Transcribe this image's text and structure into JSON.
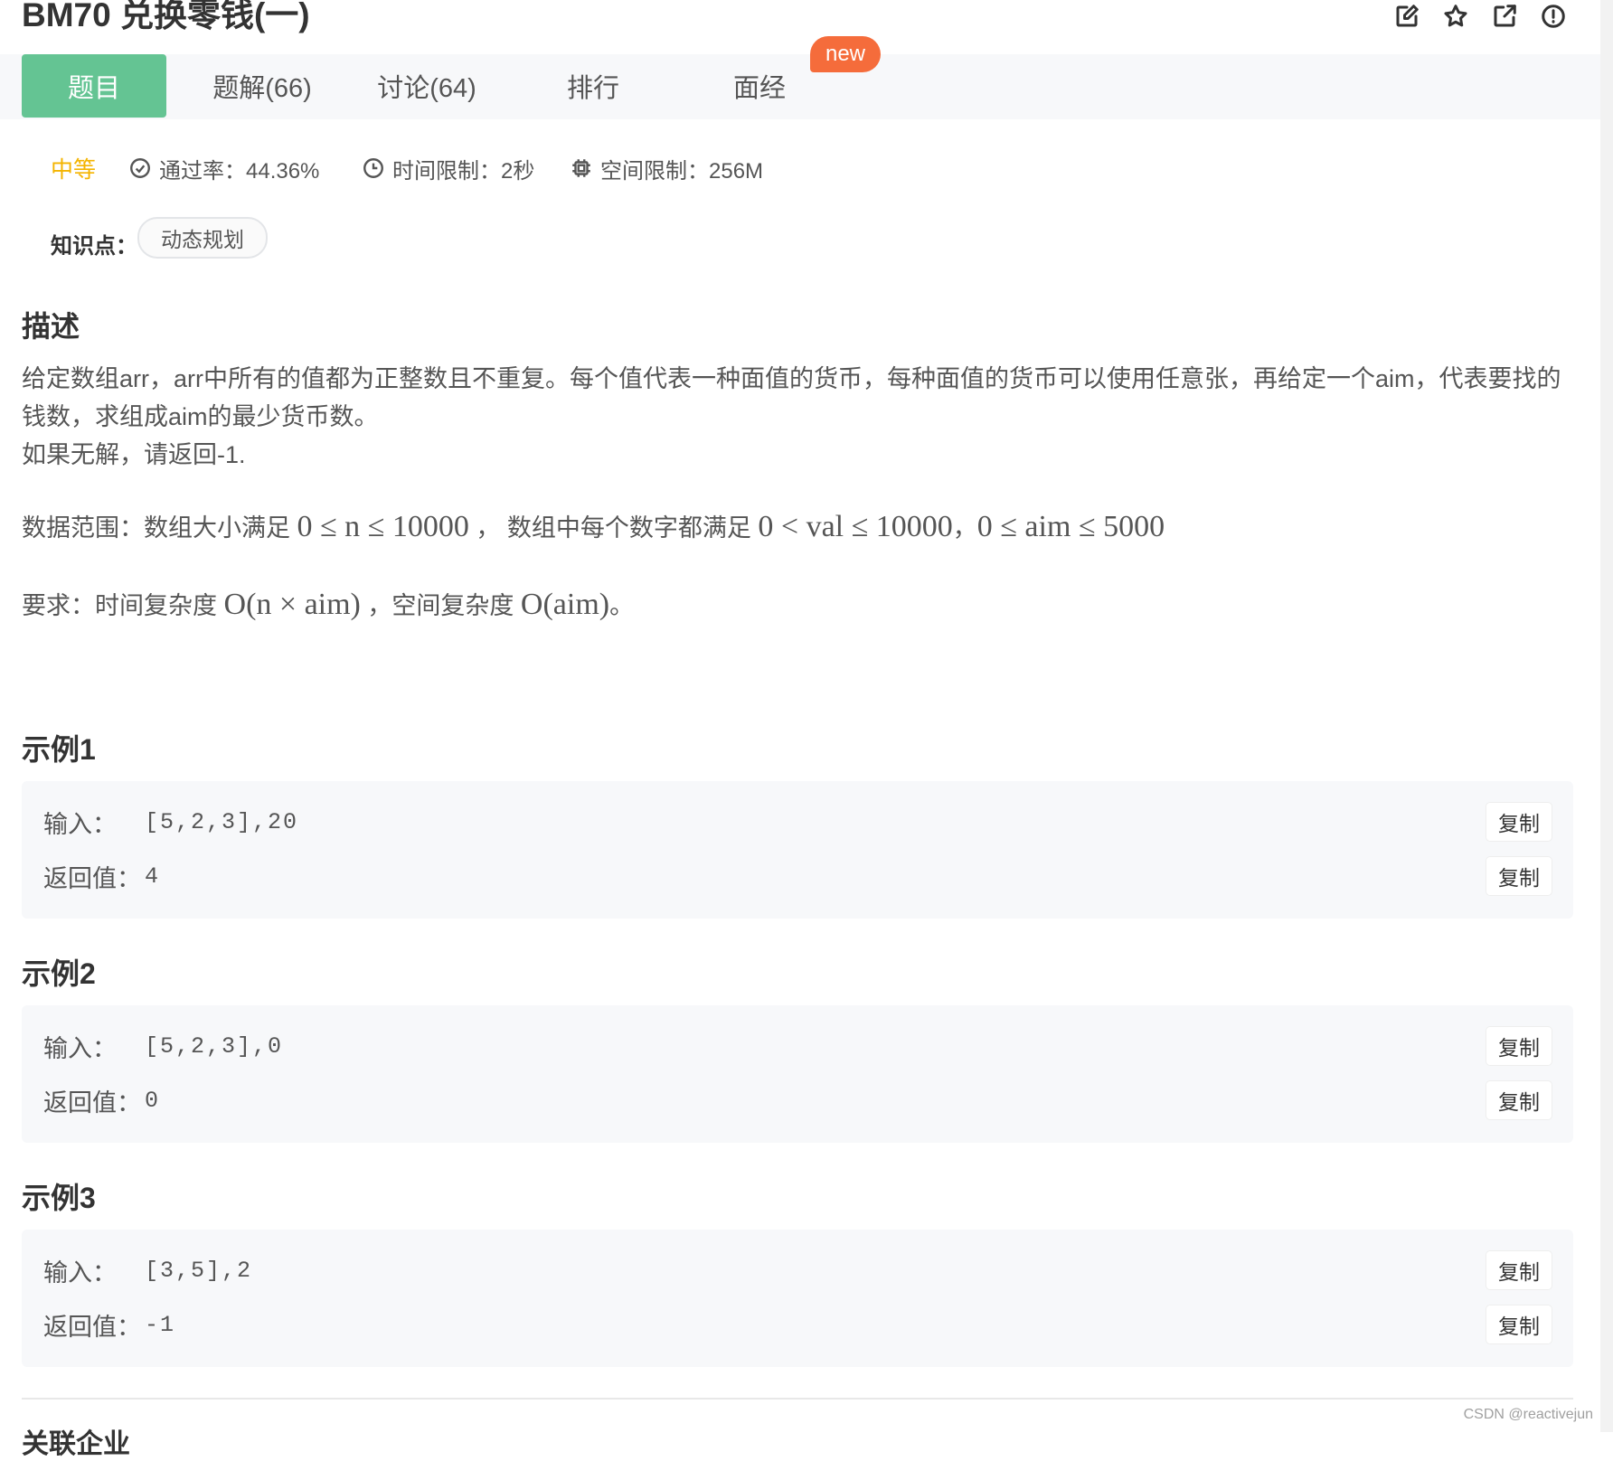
{
  "header": {
    "title": "BM70  兑换零钱(一)",
    "toolbar_icons": [
      "edit-icon",
      "star-icon",
      "share-icon",
      "report-icon"
    ]
  },
  "tabs": [
    {
      "label": "题目",
      "active": true
    },
    {
      "label": "题解(66)",
      "active": false
    },
    {
      "label": "讨论(64)",
      "active": false
    },
    {
      "label": "排行",
      "active": false
    },
    {
      "label": "面经",
      "active": false
    }
  ],
  "new_badge": "new",
  "meta": {
    "difficulty": "中等",
    "pass_rate": "通过率：44.36%",
    "time_limit": "时间限制：2秒",
    "space_limit": "空间限制：256M"
  },
  "knowledge": {
    "label": "知识点：",
    "tag": "动态规划"
  },
  "description": {
    "heading": "描述",
    "line1": "给定数组arr，arr中所有的值都为正整数且不重复。每个值代表一种面值的货币，每种面值的货币可以使用任意张，再给定一个aim，代表要找的钱数，求组成aim的最少货币数。",
    "line2": "如果无解，请返回-1.",
    "range_label": "数据范围：数组大小满足",
    "range_expr1": "0 ≤ n ≤ 10000",
    "range_mid": "， 数组中每个数字都满足",
    "range_expr2": "0 < val ≤ 10000",
    "range_sep": "，",
    "range_expr3": "0 ≤ aim ≤ 5000",
    "req_label": "要求：时间复杂度",
    "req_expr1": "O(n × aim)",
    "req_mid": "，空间复杂度",
    "req_expr2": "O(aim)",
    "req_end": "。"
  },
  "examples": [
    {
      "heading": "示例1",
      "input_label": "输入：",
      "input": "[5,2,3],20",
      "output_label": "返回值：",
      "output": "4",
      "copy": "复制"
    },
    {
      "heading": "示例2",
      "input_label": "输入：",
      "input": "[5,2,3],0",
      "output_label": "返回值：",
      "output": "0",
      "copy": "复制"
    },
    {
      "heading": "示例3",
      "input_label": "输入：",
      "input": "[3,5],2",
      "output_label": "返回值：",
      "output": "-1",
      "copy": "复制"
    }
  ],
  "footer": {
    "watermark": "CSDN @reactivejun",
    "cut_heading": "关联企业"
  },
  "colors": {
    "accent": "#64c493",
    "badge": "#f56c3b",
    "difficulty": "#f4b400"
  }
}
